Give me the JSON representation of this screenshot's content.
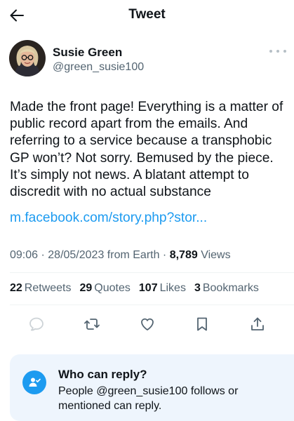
{
  "header": {
    "title": "Tweet",
    "back_icon": "arrow-left-icon"
  },
  "author": {
    "name": "Susie Green",
    "handle": "@green_susie100"
  },
  "tweet": {
    "text": "Made the front page! Everything is a matter of\npublic record apart from the emails. And\nreferring to a service because a transphobic\nGP won’t? Not sorry. Bemused by the piece.\nIt’s simply not news. A blatant attempt to\ndiscredit with no actual substance",
    "link": "m.facebook.com/story.php?stor..."
  },
  "meta": {
    "time": "09:06",
    "date": "28/05/2023",
    "source": "from Earth",
    "views_count": "8,789",
    "views_label": "Views"
  },
  "stats": [
    {
      "count": "22",
      "label": "Retweets"
    },
    {
      "count": "29",
      "label": "Quotes"
    },
    {
      "count": "107",
      "label": "Likes"
    },
    {
      "count": "3",
      "label": "Bookmarks"
    }
  ],
  "actions": [
    "reply-icon",
    "retweet-icon",
    "like-icon",
    "bookmark-icon",
    "share-icon"
  ],
  "reply_settings": {
    "title": "Who can reply?",
    "description": "People @green_susie100 follows or mentioned can reply."
  },
  "colors": {
    "accent": "#1d9bf0",
    "secondary_text": "#536471",
    "card_bg": "#eef5fd"
  }
}
